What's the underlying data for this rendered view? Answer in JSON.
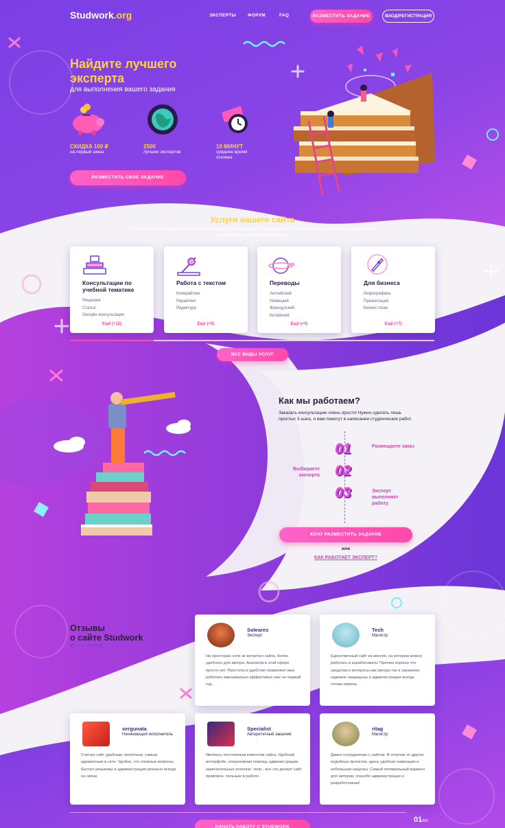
{
  "header": {
    "logo_main": "Studwork",
    "logo_suffix": ".org",
    "nav": [
      "ЭКСПЕРТЫ",
      "ФОРУМ",
      "FAQ"
    ],
    "post_task_label": "РАЗМЕСТИТЬ ЗАДАНИЕ",
    "login_label": "ВХОД/РЕГИСТРАЦИЯ"
  },
  "hero": {
    "title": "Найдите лучшего эксперта",
    "subtitle": "для выполнения вашего задания",
    "stats": [
      {
        "value": "СКИДКА 100 ₽",
        "label": "на первый заказ"
      },
      {
        "value": "2500",
        "label": "лучших экспертов"
      },
      {
        "value": "10 МИНУТ",
        "label": "среднее время отклика"
      }
    ],
    "cta": "РАЗМЕСТИТЬ СВОЕ ЗАДАНИЕ"
  },
  "services": {
    "title": "Услуги нашего сайта",
    "description": "На нашем сайте можно заказать консультацию по всем видам студенческих работ, начиная от реферата и заканчивая курсовой или дипломной работой.",
    "cards": [
      {
        "title": "Консультации по учебной тематике",
        "items": [
          "Рецензия",
          "Статья",
          "Онлайн-консультация"
        ],
        "more": "Ещё (+12)"
      },
      {
        "title": "Работа с текстом",
        "items": [
          "Копирайтинг",
          "Рерайтинг",
          "Редактура"
        ],
        "more": "Ещё (+5)"
      },
      {
        "title": "Переводы",
        "items": [
          "Английский",
          "Немецкий",
          "Французский",
          "Китайский"
        ],
        "more": "Ещё (+4)"
      },
      {
        "title": "Для бизнеса",
        "items": [
          "Инфографика",
          "Презентация",
          "Бизнес-план"
        ],
        "more": "Ещё (+7)"
      }
    ],
    "all_label": "ВСЕ ВИДЫ УСЛУГ"
  },
  "how": {
    "title": "Как мы работаем?",
    "description": "Заказать консультацию очень просто! Нужно сделать лишь простых 3 шага, и вам помогут в написании студенческих работ.",
    "steps": [
      {
        "num": "01",
        "label": "Размещаете заказ"
      },
      {
        "num": "02",
        "label": "Выбираете эксперта"
      },
      {
        "num": "03",
        "label": "Эксперт выполняет работу"
      }
    ],
    "cta": "ХОЧУ РАЗМЕСТИТЬ ЗАДАНИЕ",
    "or": "или",
    "link": "КАК РАБОТАЕТ ЭКСПЕРТ?"
  },
  "reviews": {
    "title_line1": "Отзывы",
    "title_line2": "о сайте Studwork",
    "items": [
      {
        "name": "Soleares",
        "role": "Эксперт",
        "text": "На просторах сети не встретил сайта, более удобного для автора. Аналогов в этой сфере просто нет. Простота и удобство позволяют мне работать максимально эффективно уже не первый год."
      },
      {
        "name": "Tech",
        "role": "Магистр",
        "text": "Единственный сайт из многих, на котором можно работать и зарабатывать! Причем хорошо что средства и интересы как автора так и заказчика надежно защищены и администрация всегда готова помочь."
      },
      {
        "name": "sergunata",
        "role": "Начинающий исполнитель",
        "text": "Считаю сайт удобным, понятным, самым адекватным в сети. Удобно, что спорные вопросы быстро решаемы и администрация реально всегда на связи."
      },
      {
        "name": "Specialist",
        "role": "Авторитетный заказчик",
        "text": "Являюсь постоянным клиентом сайта. Удобный интерфейс, оперативная помощь администрации, замечательные исполни- тели - все это делает сайт привлека- тельным в работе."
      },
      {
        "name": "ritag",
        "role": "Магистр",
        "text": "Давно сотрудничаю с сайтом. В отличие от других подобных проектов, здесь удобная навигация и небольшая наценка. Самый оптимальный вариант для авторов, спасибо администрации и разработчикам!"
      }
    ],
    "pager_current": "01",
    "pager_total": "/03",
    "cta": "НАЧАТЬ РАБОТУ С STUDWORK"
  }
}
